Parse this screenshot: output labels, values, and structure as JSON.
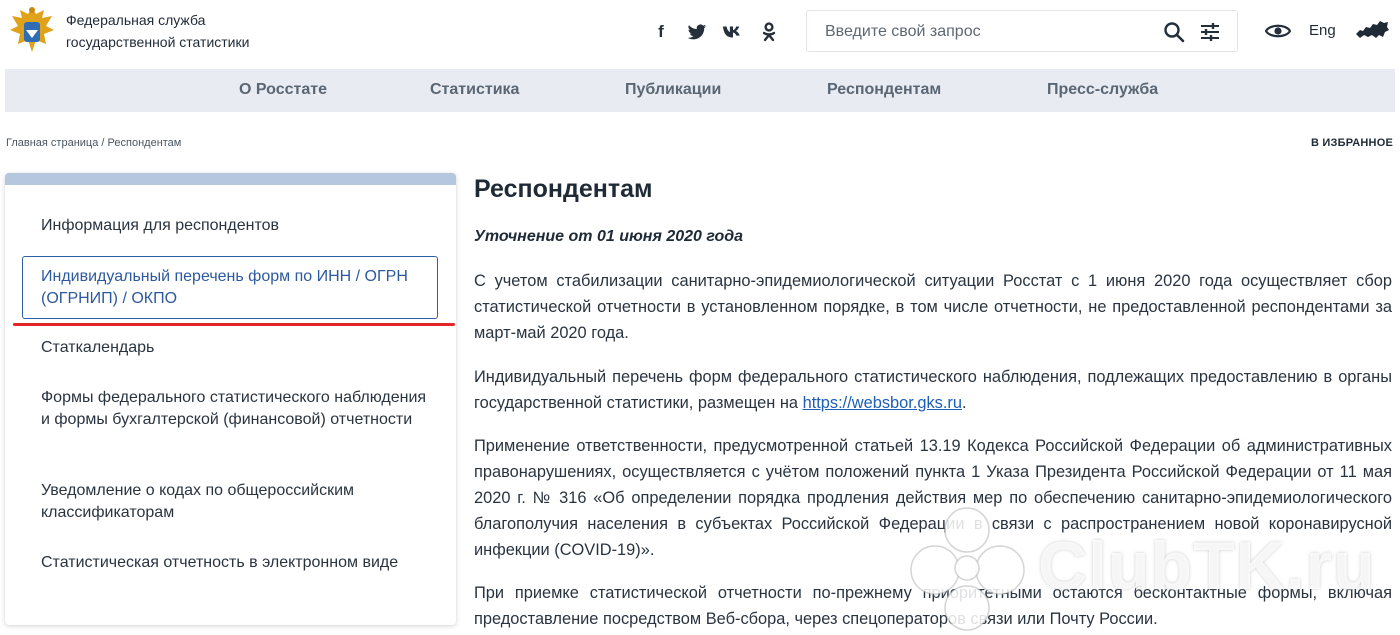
{
  "header": {
    "org_line1": "Федеральная служба",
    "org_line2": "государственной статистики",
    "social": [
      "f",
      "twitter-icon",
      "vk-icon",
      "ok-icon"
    ],
    "search_placeholder": "Введите свой запрос",
    "lang": "Eng"
  },
  "nav": {
    "items": [
      "О Росстате",
      "Статистика",
      "Публикации",
      "Респондентам",
      "Пресс-служба"
    ]
  },
  "breadcrumb": {
    "home": "Главная страница",
    "sep": "/",
    "current": "Респондентам",
    "favorite": "В ИЗБРАННОЕ"
  },
  "sidebar": {
    "items": [
      "Информация для респондентов",
      "Индивидуальный перечень форм по ИНН / ОГРН (ОГРНИП) / ОКПО",
      "Статкалендарь",
      "Формы федерального статистического наблюдения и формы бухгалтерской (финансовой) отчетности",
      "Уведомление о кодах по общероссийским классификаторам",
      "Статистическая отчетность в электронном виде"
    ]
  },
  "main": {
    "title": "Респондентам",
    "subtitle": "Уточнение от 01 июня 2020 года",
    "p1": "С учетом стабилизации санитарно-эпидемиологической ситуации Росстат с 1 июня 2020 года осуществляет сбор статистической отчетности в установленном порядке, в том числе отчетности, не предоставленной респондентами за март-май 2020 года.",
    "p2_before": "Индивидуальный перечень форм федерального статистического наблюдения, подлежащих предоставлению в органы государственной статистики, размещен на ",
    "p2_link": "https://websbor.gks.ru",
    "p2_after": ".",
    "p3": "Применение ответственности, предусмотренной статьей 13.19 Кодекса Российской Федерации об административных правонарушениях, осуществляется с учётом положений пункта 1 Указа Президента Российской Федерации от 11 мая 2020 г. № 316 «Об определении порядка продления действия мер по обеспечению санитарно-эпидемиологического благополучия населения в субъектах Российской Федерации в связи с распространением новой коронавирусной инфекции (COVID-19)».",
    "p4": "При приемке статистической отчетности по-прежнему приоритетными остаются бесконтактные формы, включая предоставление посредством Веб-сбора, через спецоператоров связи или Почту России."
  },
  "watermark": {
    "text": "ClubTK.ru"
  },
  "colors": {
    "nav_bg": "#e8ecf2",
    "accent_blue": "#2d5a9e",
    "red_line": "#e3262a",
    "link": "#1d5fb5"
  }
}
